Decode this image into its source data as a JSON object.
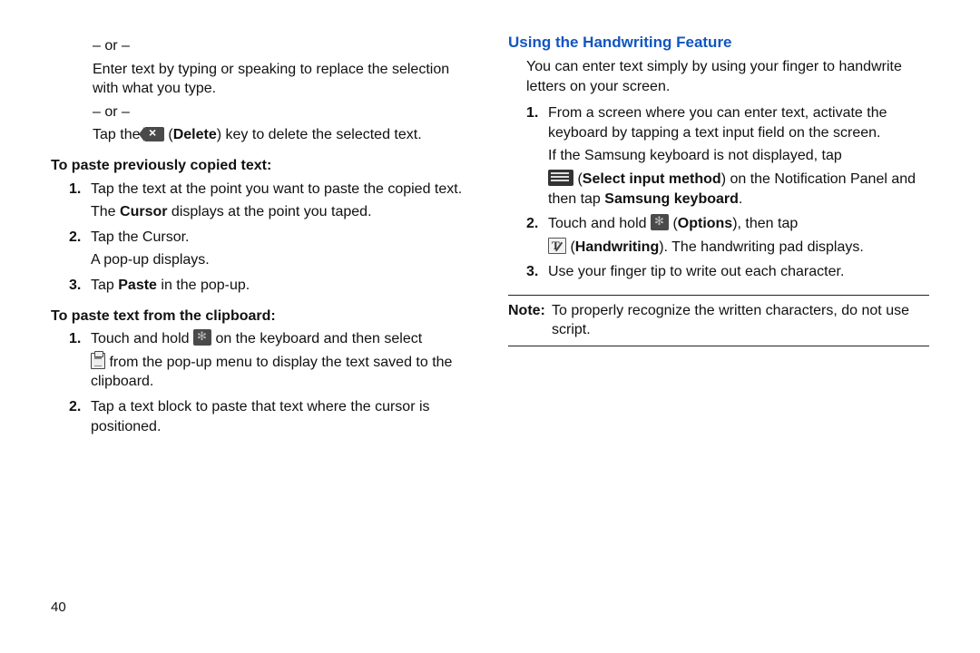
{
  "pageNumber": "40",
  "left": {
    "or1": "– or –",
    "enterText": "Enter text by typing or speaking to replace the selection with what you type.",
    "or2": "– or –",
    "tapThe": "Tap the ",
    "deleteBold": "Delete",
    "deleteTail": ") key to delete the selected text.",
    "pastePrevTitle": "To paste previously copied text:",
    "pastePrev": {
      "s1a": "Tap the text at the point you want to paste the copied text.",
      "s1b_pre": "The ",
      "s1b_bold": "Cursor",
      "s1b_post": " displays at the point you taped.",
      "s2a": "Tap the Cursor.",
      "s2b": "A pop-up displays.",
      "s3_pre": "Tap ",
      "s3_bold": "Paste",
      "s3_post": " in the pop-up."
    },
    "pasteClipTitle": "To paste text from the clipboard:",
    "pasteClip": {
      "s1a_pre": "Touch and hold ",
      "s1a_post": " on the keyboard and then select",
      "s1b": " from the pop-up menu to display the text saved to the clipboard.",
      "s2": "Tap a text block to paste that text where the cursor is positioned."
    }
  },
  "right": {
    "sectionTitle": "Using the Handwriting Feature",
    "intro": "You can enter text simply by using your finger to handwrite letters on your screen.",
    "s1a": "From a screen where you can enter text, activate the keyboard by tapping a text input field on the screen.",
    "s1b_pre": "If the Samsung keyboard is not displayed, tap",
    "s1b_boldA": "Select input method",
    "s1b_mid": ") on the Notification Panel and then tap ",
    "s1b_boldB": "Samsung keyboard",
    "s1b_post": ".",
    "s2_pre": "Touch and hold ",
    "s2_boldA": "Options",
    "s2_mid": "), then tap",
    "s2_line2_bold": "Handwriting",
    "s2_line2_post": "). The handwriting pad displays.",
    "s3": "Use your finger tip to write out each character.",
    "noteLabel": "Note:",
    "noteText": "To properly recognize the written characters, do not use script."
  },
  "nums": {
    "n1": "1.",
    "n2": "2.",
    "n3": "3."
  },
  "openParen": " (",
  "closeParen": ")"
}
